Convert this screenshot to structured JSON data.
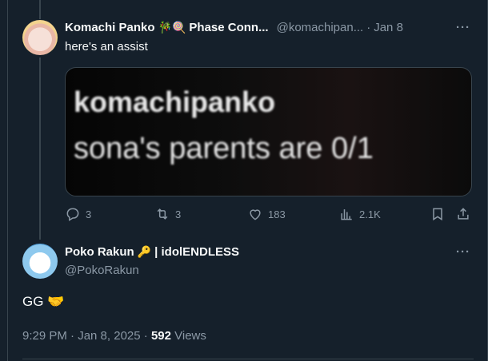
{
  "parent_tweet": {
    "display_name": "Komachi Panko",
    "display_suffix": "Phase Conn...",
    "name_emoji": "🎋🍭",
    "handle": "@komachipan...",
    "separator": "·",
    "date": "Jan 8",
    "more": "···",
    "text": "here's an assist",
    "media_text": [
      "komachipanko",
      "sona's parents are 0/1"
    ],
    "actions": {
      "replies": "3",
      "retweets": "3",
      "likes": "183",
      "views": "2.1K"
    }
  },
  "main_tweet": {
    "display_name": "Poko Rakun",
    "name_emoji": "🔑",
    "name_suffix": "| idolENDLESS",
    "handle": "@PokoRakun",
    "more": "···",
    "text": "GG 🤝",
    "timestamp": "9:29 PM · Jan 8, 2025 ·",
    "views_count": "592",
    "views_label": "Views"
  },
  "colors": {
    "background": "#15202b",
    "text_primary": "#f7f9f9",
    "text_secondary": "#8b98a5",
    "border": "#38444d"
  },
  "icons": [
    "more-icon",
    "reply-icon",
    "retweet-icon",
    "like-icon",
    "views-icon",
    "bookmark-icon",
    "share-icon"
  ]
}
